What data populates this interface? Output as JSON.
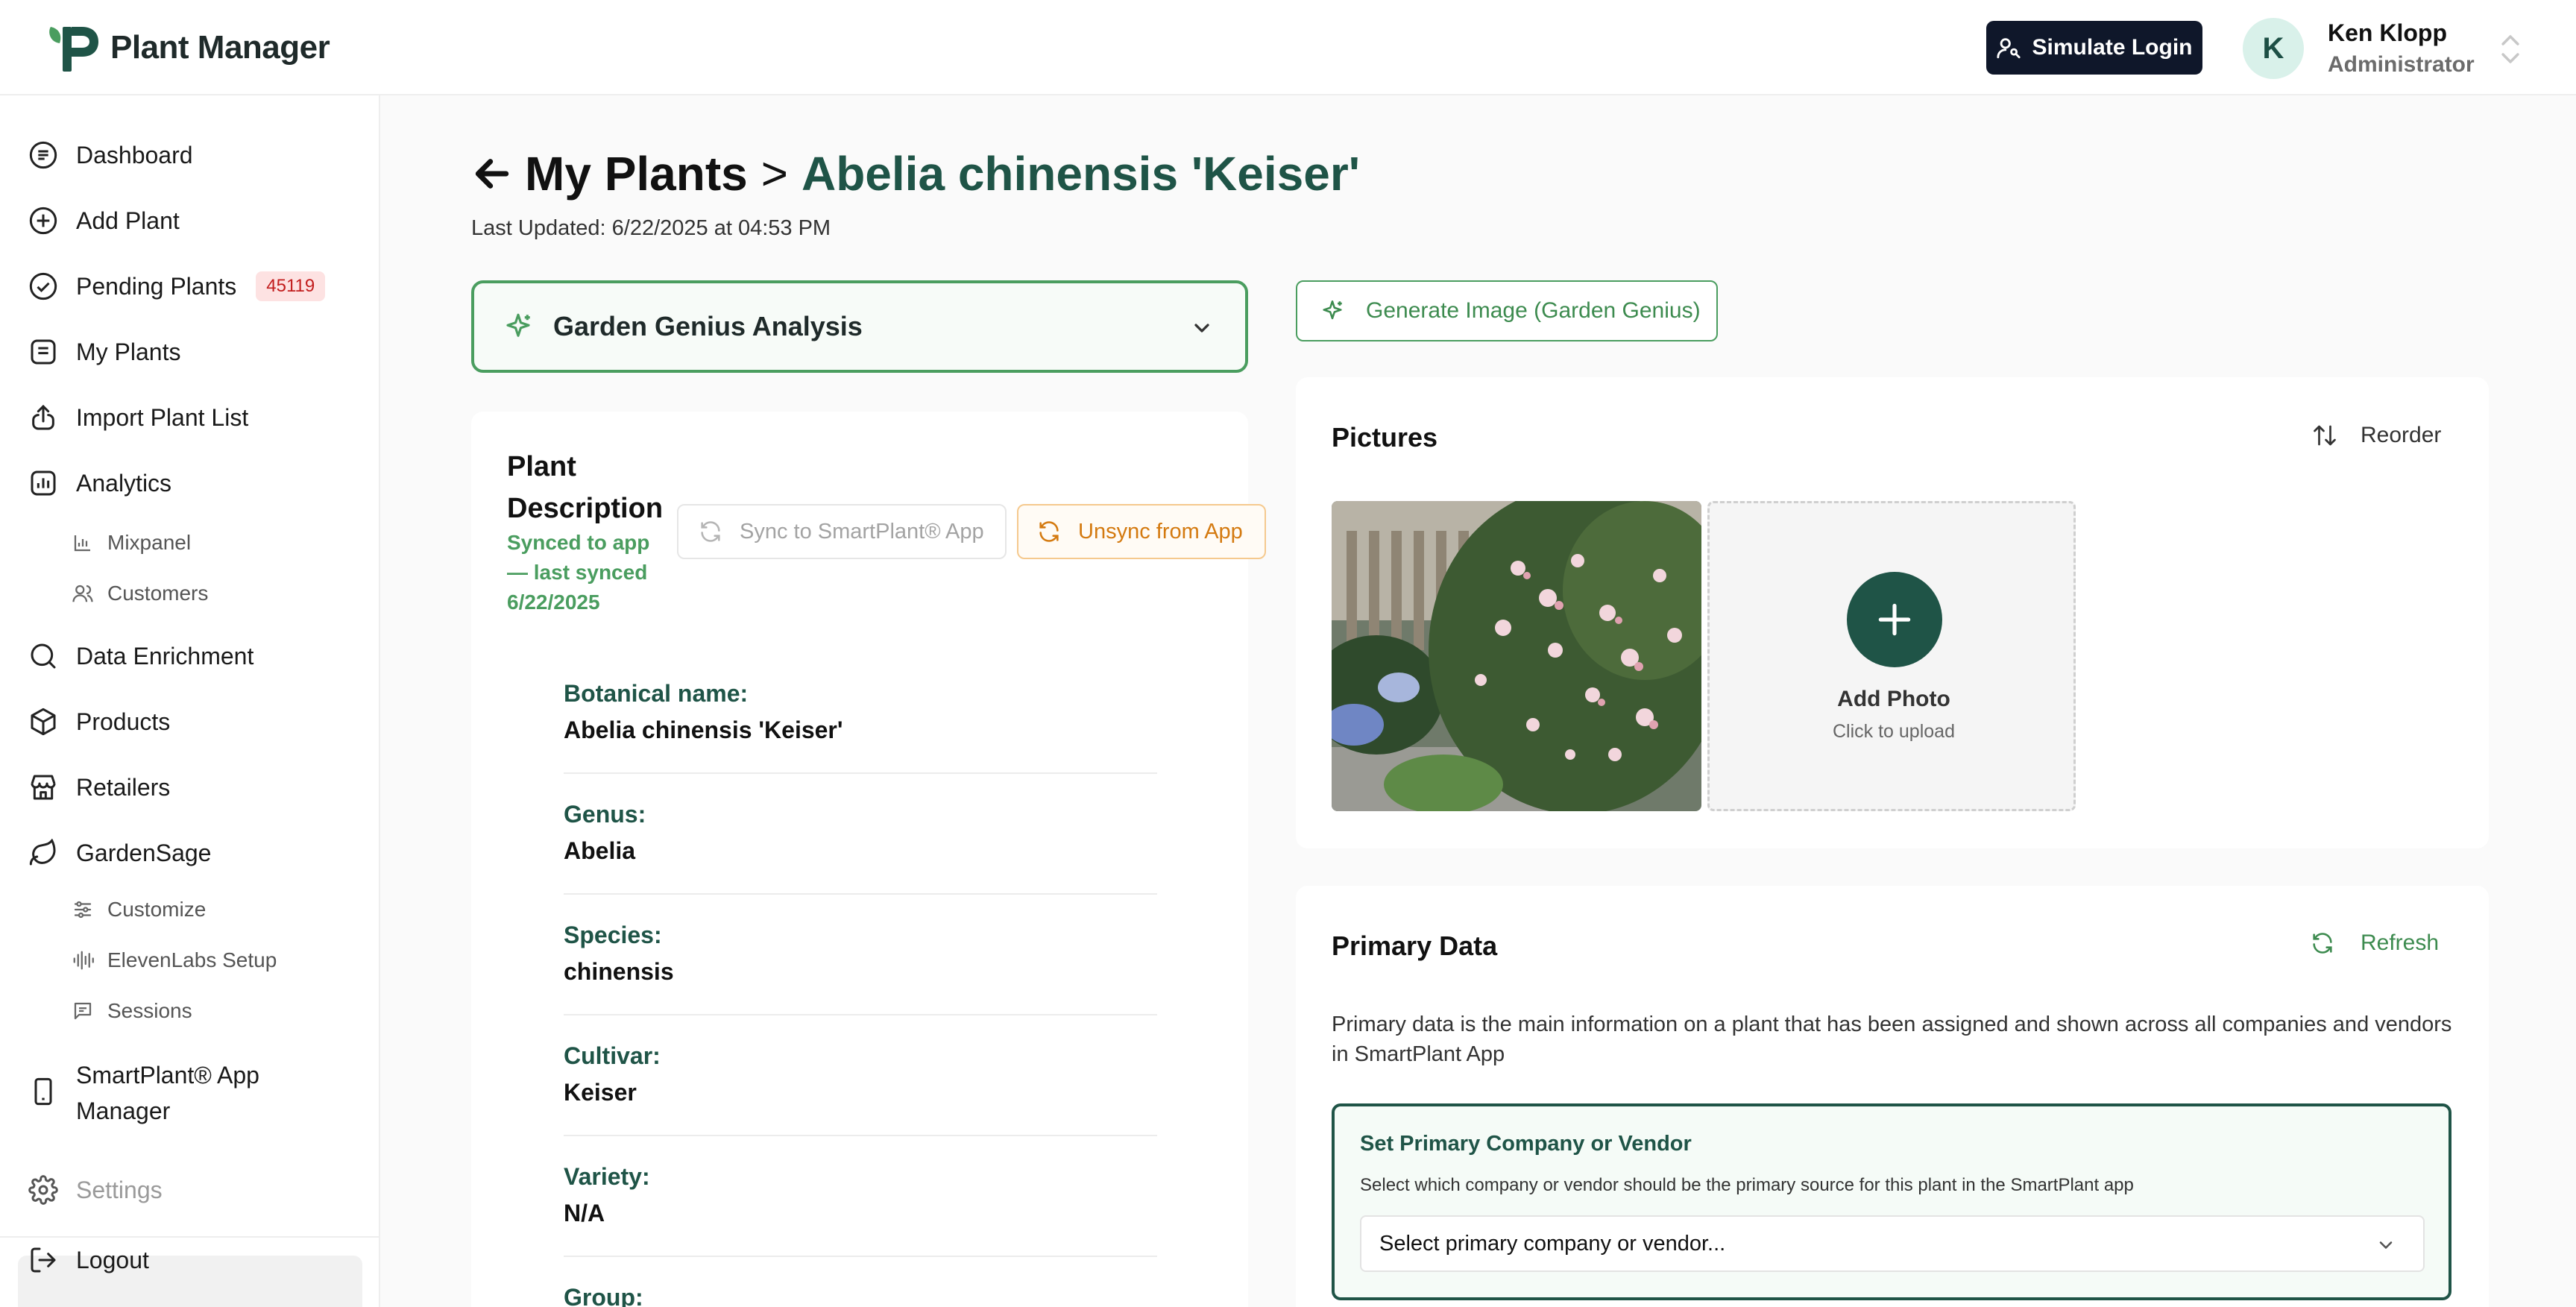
{
  "brand": {
    "name": "Plant Manager"
  },
  "header": {
    "simulate_login": "Simulate Login",
    "user_initial": "K",
    "user_name": "Ken Klopp",
    "user_role": "Administrator"
  },
  "sidebar": {
    "items": [
      {
        "label": "Dashboard",
        "icon": "dashboard-icon"
      },
      {
        "label": "Add Plant",
        "icon": "plus-circle-icon"
      },
      {
        "label": "Pending Plants",
        "icon": "check-circle-icon",
        "badge": "45119"
      },
      {
        "label": "My Plants",
        "icon": "list-icon"
      },
      {
        "label": "Import Plant List",
        "icon": "upload-icon"
      },
      {
        "label": "Analytics",
        "icon": "chart-icon"
      },
      {
        "label": "Data Enrichment",
        "icon": "search-icon"
      },
      {
        "label": "Products",
        "icon": "box-icon"
      },
      {
        "label": "Retailers",
        "icon": "store-icon"
      },
      {
        "label": "GardenSage",
        "icon": "leaf-icon"
      },
      {
        "label": "SmartPlant® App",
        "label2": "Manager",
        "icon": "phone-icon"
      },
      {
        "label": "Settings",
        "icon": "gear-icon"
      },
      {
        "label": "Logout",
        "icon": "logout-icon"
      }
    ],
    "analytics_sub": [
      {
        "label": "Mixpanel",
        "icon": "bar-chart-icon"
      },
      {
        "label": "Customers",
        "icon": "users-icon"
      }
    ],
    "gardensage_sub": [
      {
        "label": "Customize",
        "icon": "sliders-icon"
      },
      {
        "label": "ElevenLabs Setup",
        "icon": "audio-wave-icon"
      },
      {
        "label": "Sessions",
        "icon": "chat-icon"
      }
    ]
  },
  "page": {
    "crumb": "My Plants",
    "sep": ">",
    "plant_name": "Abelia chinensis 'Keiser'",
    "last_updated": "Last Updated: 6/22/2025 at 04:53 PM",
    "genius_label": "Garden Genius Analysis",
    "generate_image": "Generate Image (Garden Genius)"
  },
  "description": {
    "title_line1": "Plant",
    "title_line2": "Description",
    "synced_line1": "Synced to app",
    "synced_line2": "— last synced",
    "synced_line3": "6/22/2025",
    "sync_btn": "Sync to SmartPlant® App",
    "unsync_btn": "Unsync from App",
    "fields": [
      {
        "label": "Botanical name:",
        "value": "Abelia chinensis 'Keiser'"
      },
      {
        "label": "Genus:",
        "value": "Abelia"
      },
      {
        "label": "Species:",
        "value": "chinensis"
      },
      {
        "label": "Cultivar:",
        "value": "Keiser"
      },
      {
        "label": "Variety:",
        "value": "N/A"
      },
      {
        "label": "Group:",
        "value": ""
      }
    ]
  },
  "pictures": {
    "title": "Pictures",
    "reorder": "Reorder",
    "add_photo": "Add Photo",
    "add_photo_sub": "Click to upload"
  },
  "primary": {
    "title": "Primary Data",
    "refresh": "Refresh",
    "description": "Primary data is the main information on a plant that has been assigned and shown across all companies and vendors in SmartPlant App",
    "vendor_title": "Set Primary Company or Vendor",
    "vendor_sub": "Select which company or vendor should be the primary source for this plant in the SmartPlant app",
    "vendor_placeholder": "Select primary company or vendor..."
  },
  "colors": {
    "accent_green": "#1f5447",
    "light_green": "#4a9d5f",
    "orange": "#d47a10",
    "badge_red": "#c21d1d"
  }
}
